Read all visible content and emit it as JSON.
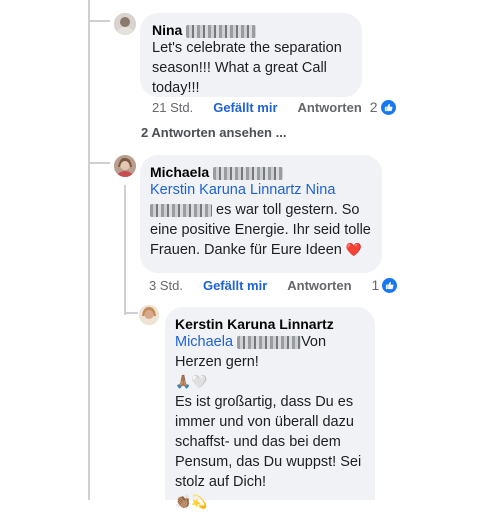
{
  "comments": [
    {
      "author_first": "Nina",
      "text": "Let's celebrate the separation season!!! What a great Call today!!!",
      "time": "21 Std.",
      "like_label": "Gefällt mir",
      "reply_label": "Antworten",
      "reaction_count": "2"
    },
    {
      "author_first": "Michaela",
      "mention_name": "Kerstin Karuna Linnartz Nina",
      "text": " es war toll gestern. So eine positive Energie. Ihr seid tolle Frauen. Danke für Eure Ideen",
      "text_emoji": "❤️",
      "time": "3 Std.",
      "like_label": "Gefällt mir",
      "reply_label": "Antworten",
      "reaction_count": "1"
    },
    {
      "author": "Kerstin Karuna Linnartz",
      "mention_name": "Michaela",
      "text_start": "Von Herzen gern!",
      "emoji_line": "🙏🏽🤍",
      "text": "Es ist großartig, dass Du es immer und von überall dazu schaffst- und das bei dem Pensum, das Du wuppst! Sei stolz auf Dich!",
      "end_emoji": "👏🏽💫"
    }
  ],
  "view_replies_label": "2 Antworten ansehen ..."
}
